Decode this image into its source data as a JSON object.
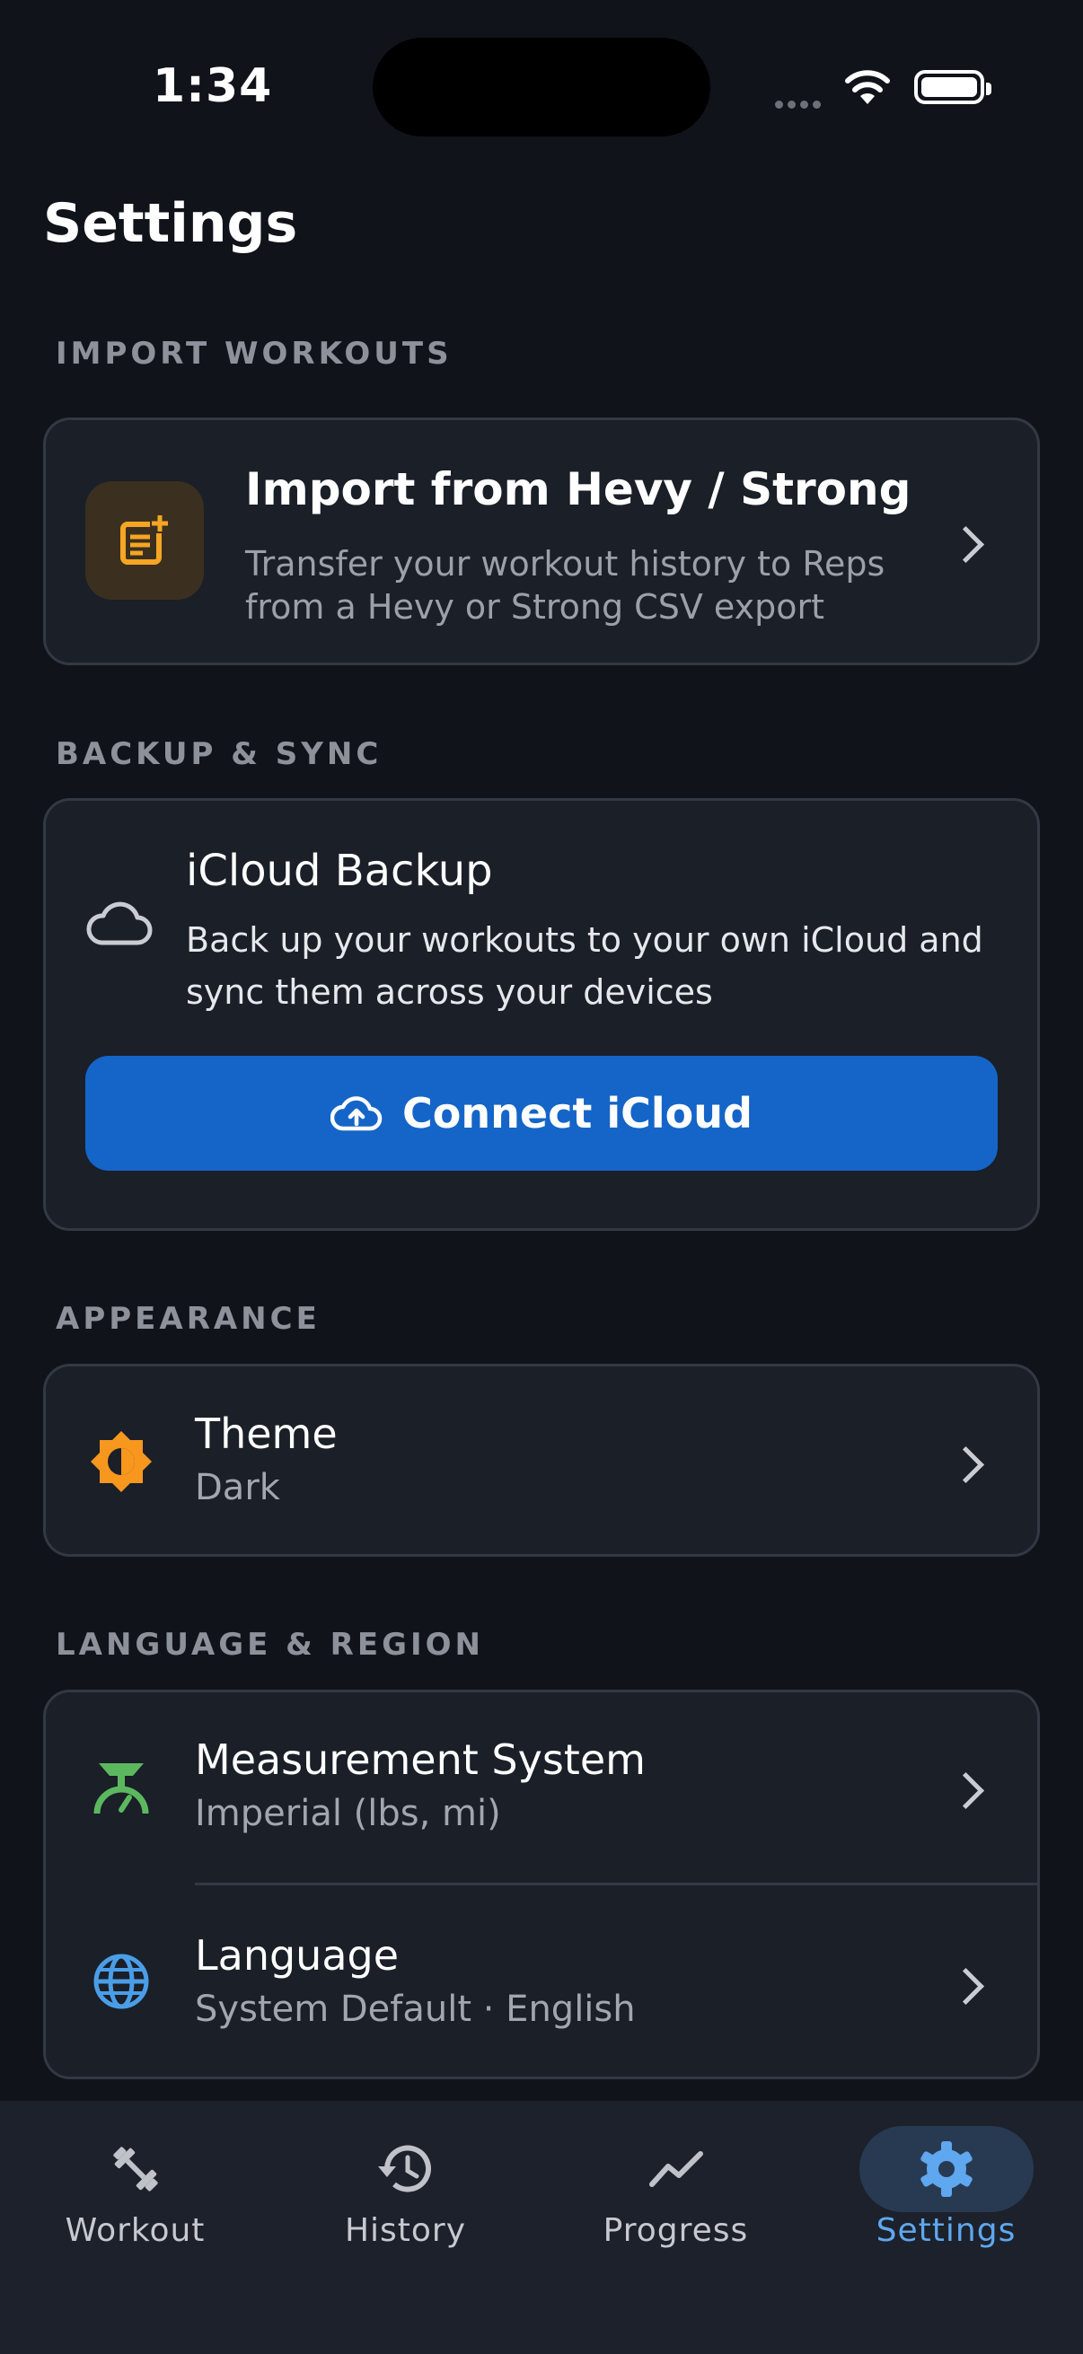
{
  "status_bar": {
    "time": "1:34"
  },
  "page": {
    "title": "Settings"
  },
  "sections": {
    "import": {
      "header": "IMPORT WORKOUTS",
      "title": "Import from Hevy / Strong",
      "subtitle": "Transfer your workout history to Reps from a Hevy or Strong CSV export",
      "icon": "import-file-icon",
      "icon_color": "#f6a623"
    },
    "backup": {
      "header": "BACKUP & SYNC",
      "title": "iCloud Backup",
      "subtitle": "Back up your workouts to your own iCloud and sync them across your devices",
      "button_label": "Connect iCloud",
      "button_color": "#1565c8"
    },
    "appearance": {
      "header": "APPEARANCE",
      "theme_title": "Theme",
      "theme_value": "Dark",
      "icon_color": "#f7971e"
    },
    "language_region": {
      "header": "LANGUAGE & REGION",
      "measurement_title": "Measurement System",
      "measurement_value": "Imperial (lbs, mi)",
      "measurement_icon_color": "#5cb85f",
      "language_title": "Language",
      "language_value": "System Default · English",
      "language_icon_color": "#4a9ee8"
    }
  },
  "tabs": [
    {
      "label": "Workout",
      "icon": "dumbbell-icon"
    },
    {
      "label": "History",
      "icon": "history-icon"
    },
    {
      "label": "Progress",
      "icon": "trend-icon"
    },
    {
      "label": "Settings",
      "icon": "gear-icon",
      "active": true
    }
  ],
  "accent_color": "#5fa7ef"
}
